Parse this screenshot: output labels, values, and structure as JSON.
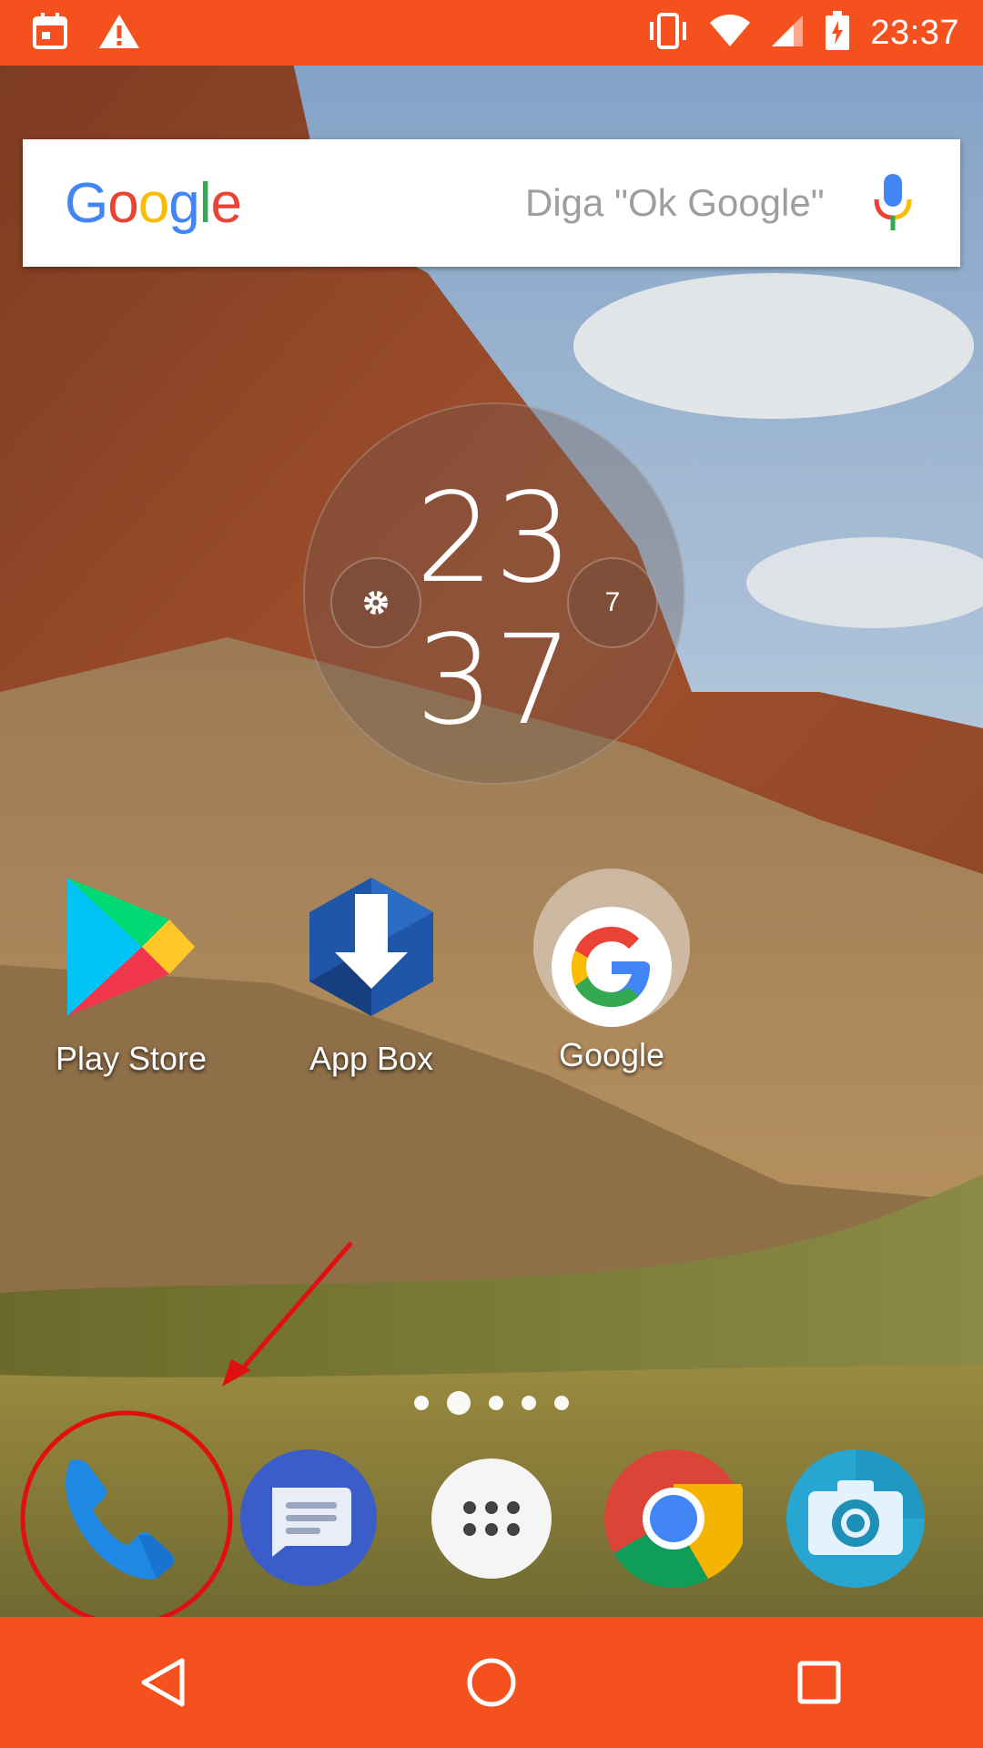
{
  "status_bar": {
    "time": "23:37",
    "left_icons": [
      "calendar-icon",
      "warning-icon"
    ],
    "right_icons": [
      "vibrate-icon",
      "wifi-icon",
      "signal-icon",
      "battery-charging-icon"
    ],
    "background_color": "#F5511E"
  },
  "search": {
    "logo_letters": [
      "G",
      "o",
      "o",
      "g",
      "l",
      "e"
    ],
    "hint": "Diga \"Ok Google\"",
    "mic_icon": "mic-icon"
  },
  "clock_widget": {
    "hour": "23",
    "minute": "37",
    "settings_icon": "gear-icon",
    "weather_value": "7"
  },
  "apps": [
    {
      "label": "Play Store",
      "icon": "play-store-icon"
    },
    {
      "label": "App Box",
      "icon": "app-box-icon"
    },
    {
      "label": "Google",
      "icon": "google-folder-icon"
    }
  ],
  "page_indicator": {
    "count": 5,
    "active_index": 1
  },
  "dock": [
    {
      "name": "phone",
      "icon": "phone-icon"
    },
    {
      "name": "messages",
      "icon": "messages-icon"
    },
    {
      "name": "app-drawer",
      "icon": "app-drawer-icon"
    },
    {
      "name": "chrome",
      "icon": "chrome-icon"
    },
    {
      "name": "camera",
      "icon": "camera-icon"
    }
  ],
  "annotation": {
    "color": "#E01010",
    "target": "phone"
  },
  "nav_bar": {
    "buttons": [
      "back-icon",
      "home-icon",
      "recents-icon"
    ],
    "background_color": "#F5511E"
  }
}
